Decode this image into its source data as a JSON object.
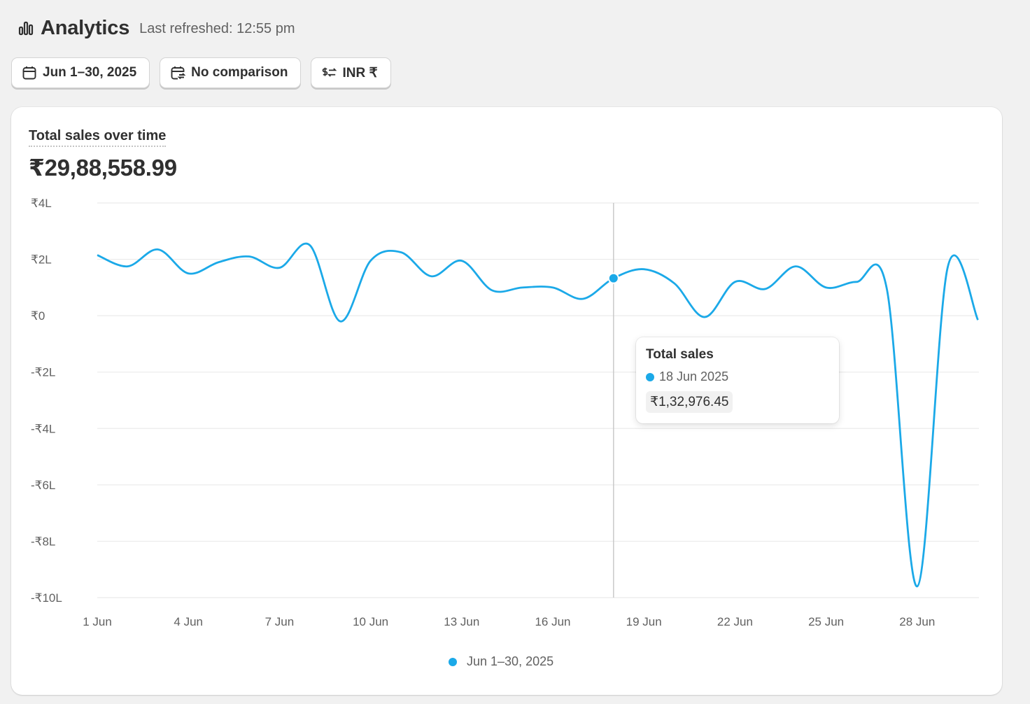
{
  "header": {
    "title": "Analytics",
    "last_refreshed": "Last refreshed: 12:55 pm",
    "icon": "bar-chart-icon"
  },
  "filters": {
    "date_range": {
      "label": "Jun 1–30, 2025",
      "icon": "calendar-icon"
    },
    "comparison": {
      "label": "No comparison",
      "icon": "calendar-compare-icon"
    },
    "currency": {
      "label": "INR ₹",
      "icon": "currency-exchange-icon"
    }
  },
  "card": {
    "title": "Total sales over time",
    "total": "₹29,88,558.99"
  },
  "tooltip": {
    "title": "Total sales",
    "date": "18 Jun 2025",
    "value": "₹1,32,976.45"
  },
  "legend": {
    "label": "Jun 1–30, 2025"
  },
  "colors": {
    "series": "#1ba9e8",
    "grid": "#ebebeb",
    "crosshair": "#c9c9c9"
  },
  "chart_data": {
    "type": "line",
    "title": "Total sales over time",
    "x_tick_labels": [
      "1 Jun",
      "4 Jun",
      "7 Jun",
      "10 Jun",
      "13 Jun",
      "16 Jun",
      "19 Jun",
      "22 Jun",
      "25 Jun",
      "28 Jun"
    ],
    "y_tick_labels": [
      "₹4L",
      "₹2L",
      "₹0",
      "-₹2L",
      "-₹4L",
      "-₹6L",
      "-₹8L",
      "-₹10L"
    ],
    "ylim": [
      -1000000,
      400000
    ],
    "series": [
      {
        "name": "Jun 1–30, 2025",
        "x": [
          "1 Jun",
          "2 Jun",
          "3 Jun",
          "4 Jun",
          "5 Jun",
          "6 Jun",
          "7 Jun",
          "8 Jun",
          "9 Jun",
          "10 Jun",
          "11 Jun",
          "12 Jun",
          "13 Jun",
          "14 Jun",
          "15 Jun",
          "16 Jun",
          "17 Jun",
          "18 Jun",
          "19 Jun",
          "20 Jun",
          "21 Jun",
          "22 Jun",
          "23 Jun",
          "24 Jun",
          "25 Jun",
          "26 Jun",
          "27 Jun",
          "28 Jun",
          "29 Jun",
          "30 Jun"
        ],
        "values": [
          215000,
          175000,
          235000,
          150000,
          190000,
          210000,
          170000,
          250000,
          -20000,
          195000,
          225000,
          140000,
          195000,
          90000,
          100000,
          100000,
          60000,
          132976,
          165000,
          115000,
          -5000,
          120000,
          95000,
          175000,
          100000,
          120000,
          95000,
          -960000,
          170000,
          -15000
        ]
      }
    ],
    "highlight": {
      "x": "18 Jun",
      "value": 132976.45
    },
    "grid": true,
    "legend_position": "bottom-center"
  }
}
